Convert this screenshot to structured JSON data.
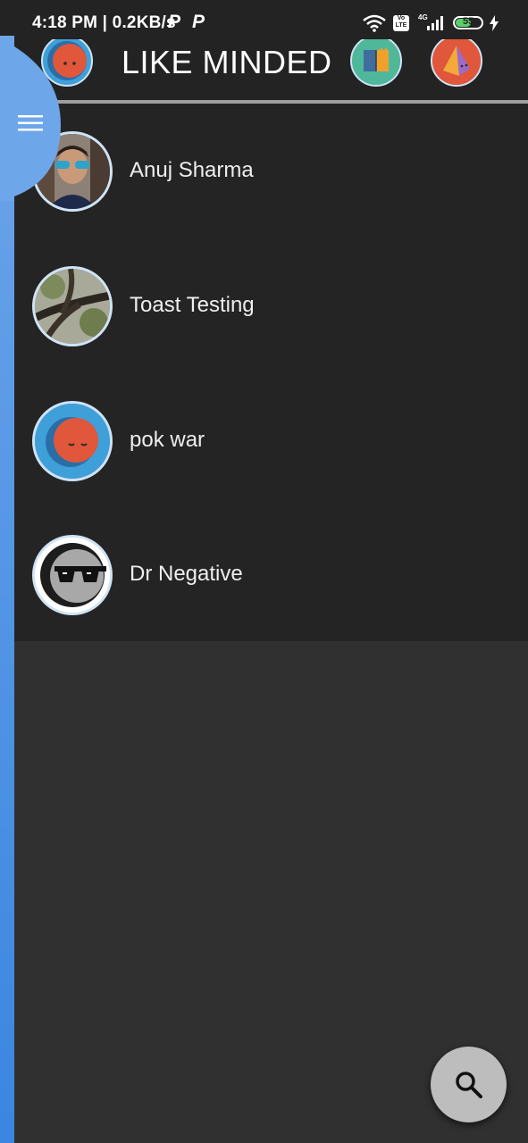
{
  "status_bar": {
    "time": "4:18 PM | 0.2KB/s",
    "notification_glyph": "P",
    "network": "4G",
    "volte": "Vo LTE",
    "battery": "55"
  },
  "header": {
    "title": "LIKE MINDED"
  },
  "contacts": [
    {
      "name": "Anuj Sharma"
    },
    {
      "name": "Toast Testing"
    },
    {
      "name": "pok war"
    },
    {
      "name": "Dr Negative"
    }
  ],
  "colors": {
    "accent": "#3a86e0",
    "header_bg": "#232323",
    "list_bg": "#242424",
    "page_bg": "#303030",
    "fab": "#bdbdbd"
  },
  "icons": {
    "menu": "hamburger-icon",
    "search": "search-icon"
  }
}
